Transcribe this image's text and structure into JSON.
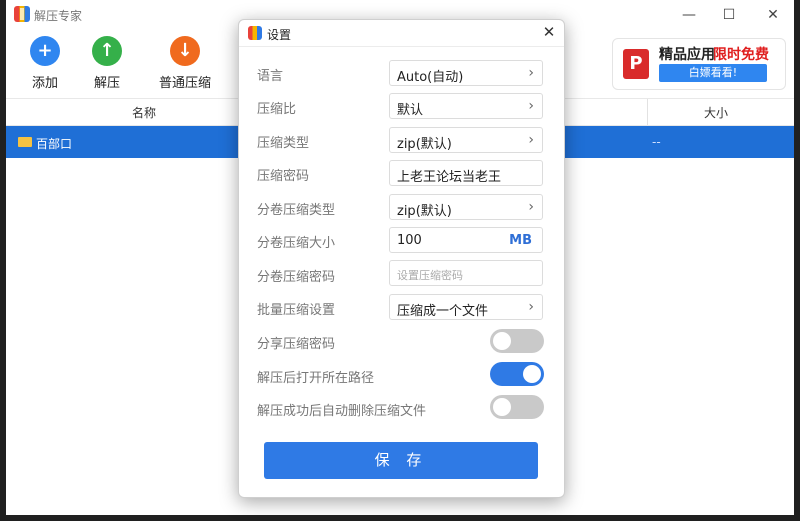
{
  "window": {
    "title": "解压专家",
    "min": "—",
    "max": "☐",
    "close": "✕"
  },
  "toolbar": {
    "items": [
      {
        "label": "添加",
        "icon": "add-icon",
        "color": "#2f86f0",
        "glyph": "+"
      },
      {
        "label": "解压",
        "icon": "extract-icon",
        "color": "#35b04a",
        "glyph": "↑"
      },
      {
        "label": "普通压缩",
        "icon": "compress-icon",
        "color": "#f06a1e",
        "glyph": "↓"
      }
    ]
  },
  "ad": {
    "title": "精品应用",
    "highlight": "限时免费",
    "button": "白嫖看看!",
    "logo": "P"
  },
  "list": {
    "columns": [
      "名称",
      "大小"
    ],
    "rows": [
      {
        "name": "百部口",
        "size": "--"
      }
    ]
  },
  "dialog": {
    "title": "设置",
    "close": "✕",
    "settings": [
      {
        "label": "语言",
        "value": "Auto(自动)",
        "type": "select"
      },
      {
        "label": "压缩比",
        "value": "默认",
        "type": "select"
      },
      {
        "label": "压缩类型",
        "value": "zip(默认)",
        "type": "select"
      },
      {
        "label": "压缩密码",
        "value": "上老王论坛当老王",
        "type": "input"
      },
      {
        "label": "分卷压缩类型",
        "value": "zip(默认)",
        "type": "select"
      },
      {
        "label": "分卷压缩大小",
        "value": "100",
        "unit": "MB",
        "type": "number"
      },
      {
        "label": "分卷压缩密码",
        "placeholder": "设置压缩密码",
        "type": "password"
      },
      {
        "label": "批量压缩设置",
        "value": "压缩成一个文件",
        "type": "select"
      }
    ],
    "toggles": [
      {
        "label": "分享压缩密码",
        "on": false
      },
      {
        "label": "解压后打开所在路径",
        "on": true
      },
      {
        "label": "解压成功后自动删除压缩文件",
        "on": false
      }
    ],
    "save_label": "保 存"
  },
  "colors": {
    "accent": "#2f7ae5",
    "selection": "#1f6fd6",
    "ad_red": "#e02020"
  }
}
